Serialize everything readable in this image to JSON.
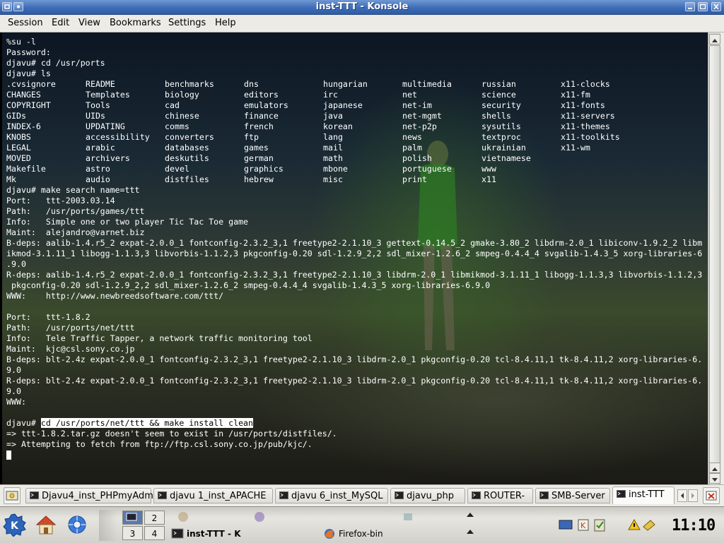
{
  "window": {
    "title": "inst-TTT - Konsole"
  },
  "menu": [
    "Session",
    "Edit",
    "View",
    "Bookmarks",
    "Settings",
    "Help"
  ],
  "terminal": {
    "pre_lines": [
      "%su -l",
      "Password:",
      "djavu# cd /usr/ports",
      "djavu# ls"
    ],
    "ls_columns": [
      [
        ".cvsignore",
        "CHANGES",
        "COPYRIGHT",
        "GIDs",
        "INDEX-6",
        "KNOBS",
        "LEGAL",
        "MOVED",
        "Makefile",
        "Mk"
      ],
      [
        "README",
        "Templates",
        "Tools",
        "UIDs",
        "UPDATING",
        "accessibility",
        "arabic",
        "archivers",
        "astro",
        "audio"
      ],
      [
        "benchmarks",
        "biology",
        "cad",
        "chinese",
        "comms",
        "converters",
        "databases",
        "deskutils",
        "devel",
        "distfiles"
      ],
      [
        "dns",
        "editors",
        "emulators",
        "finance",
        "french",
        "ftp",
        "games",
        "german",
        "graphics",
        "hebrew"
      ],
      [
        "hungarian",
        "irc",
        "japanese",
        "java",
        "korean",
        "lang",
        "mail",
        "math",
        "mbone",
        "misc"
      ],
      [
        "multimedia",
        "net",
        "net-im",
        "net-mgmt",
        "net-p2p",
        "news",
        "palm",
        "polish",
        "portuguese",
        "print"
      ],
      [
        "russian",
        "science",
        "security",
        "shells",
        "sysutils",
        "textproc",
        "ukrainian",
        "vietnamese",
        "www",
        "x11"
      ],
      [
        "x11-clocks",
        "x11-fm",
        "x11-fonts",
        "x11-servers",
        "x11-themes",
        "x11-toolkits",
        "x11-wm"
      ]
    ],
    "post_lines": [
      "djavu# make search name=ttt",
      "Port:   ttt-2003.03.14",
      "Path:   /usr/ports/games/ttt",
      "Info:   Simple one or two player Tic Tac Toe game",
      "Maint:  alejandro@varnet.biz",
      "B-deps: aalib-1.4.r5_2 expat-2.0.0_1 fontconfig-2.3.2_3,1 freetype2-2.1.10_3 gettext-0.14.5_2 gmake-3.80_2 libdrm-2.0_1 libiconv-1.9.2_2 libm",
      "ikmod-3.1.11_1 libogg-1.1.3,3 libvorbis-1.1.2,3 pkgconfig-0.20 sdl-1.2.9_2,2 sdl_mixer-1.2.6_2 smpeg-0.4.4_4 svgalib-1.4.3_5 xorg-libraries-6",
      ".9.0",
      "R-deps: aalib-1.4.r5_2 expat-2.0.0_1 fontconfig-2.3.2_3,1 freetype2-2.1.10_3 libdrm-2.0_1 libmikmod-3.1.11_1 libogg-1.1.3,3 libvorbis-1.1.2,3",
      " pkgconfig-0.20 sdl-1.2.9_2,2 sdl_mixer-1.2.6_2 smpeg-0.4.4_4 svgalib-1.4.3_5 xorg-libraries-6.9.0",
      "WWW:    http://www.newbreedsoftware.com/ttt/",
      "",
      "Port:   ttt-1.8.2",
      "Path:   /usr/ports/net/ttt",
      "Info:   Tele Traffic Tapper, a network traffic monitoring tool",
      "Maint:  kjc@csl.sony.co.jp",
      "B-deps: blt-2.4z expat-2.0.0_1 fontconfig-2.3.2_3,1 freetype2-2.1.10_3 libdrm-2.0_1 pkgconfig-0.20 tcl-8.4.11,1 tk-8.4.11,2 xorg-libraries-6.",
      "9.0",
      "R-deps: blt-2.4z expat-2.0.0_1 fontconfig-2.3.2_3,1 freetype2-2.1.10_3 libdrm-2.0_1 pkgconfig-0.20 tcl-8.4.11,1 tk-8.4.11,2 xorg-libraries-6.",
      "9.0",
      "WWW:",
      "",
      "djavu# make search name=ttt"
    ],
    "prompt": "djavu# ",
    "selected_command": "cd /usr/ports/net/ttt && make install clean",
    "output_lines": [
      "=> ttt-1.8.2.tar.gz doesn't seem to exist in /usr/ports/distfiles/.",
      "=> Attempting to fetch from ftp://ftp.csl.sony.co.jp/pub/kjc/."
    ]
  },
  "tabs": [
    {
      "label": "Djavu4_inst_PHPmyAdm",
      "active": false
    },
    {
      "label": "djavu 1_inst_APACHE",
      "active": false
    },
    {
      "label": "djavu 6_inst_MySQL",
      "active": false
    },
    {
      "label": "djavu_php",
      "active": false
    },
    {
      "label": "ROUTER-",
      "active": false
    },
    {
      "label": "SMB-Server",
      "active": false
    },
    {
      "label": "inst-TTT",
      "active": true
    }
  ],
  "panel": {
    "pager": [
      "1",
      "2",
      "3",
      "4"
    ],
    "tasks": [
      {
        "label": "inst-TTT - K",
        "icon": "konsole-icon"
      },
      {
        "label": "Firefox-bin",
        "icon": "firefox-icon"
      }
    ],
    "clock": "11:10",
    "colors": {
      "accent": "#3e6cb6",
      "panel": "#dddcd6"
    }
  }
}
